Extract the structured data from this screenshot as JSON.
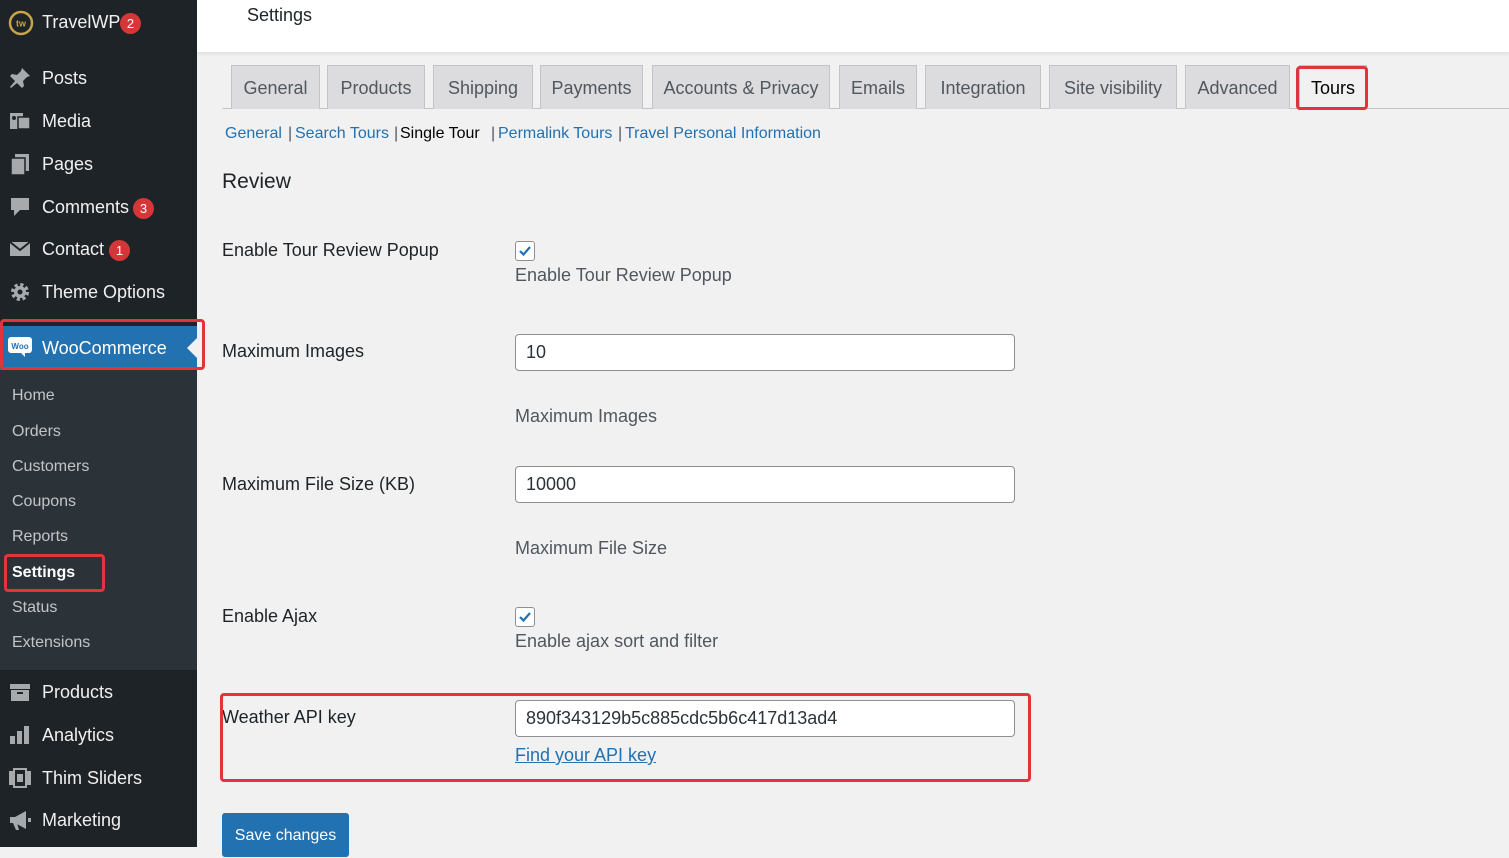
{
  "sidebar": {
    "site": {
      "label": "TravelWP",
      "badge": "2",
      "logo_text": "tw"
    },
    "items": [
      {
        "label": "Posts",
        "icon": "pushpin-icon"
      },
      {
        "label": "Media",
        "icon": "media-icon"
      },
      {
        "label": "Pages",
        "icon": "pages-icon"
      },
      {
        "label": "Comments",
        "icon": "comment-icon",
        "badge": "3"
      },
      {
        "label": "Contact",
        "icon": "envelope-icon",
        "badge": "1"
      },
      {
        "label": "Theme Options",
        "icon": "gear-icon"
      }
    ],
    "woocommerce": {
      "label": "WooCommerce",
      "icon": "woo-icon",
      "icon_text": "Woo"
    },
    "submenu": [
      "Home",
      "Orders",
      "Customers",
      "Coupons",
      "Reports",
      "Settings",
      "Status",
      "Extensions"
    ],
    "bottom_items": [
      {
        "label": "Products",
        "icon": "archive-icon"
      },
      {
        "label": "Analytics",
        "icon": "bar-chart-icon"
      },
      {
        "label": "Thim Sliders",
        "icon": "slides-icon"
      },
      {
        "label": "Marketing",
        "icon": "megaphone-icon"
      }
    ]
  },
  "header": {
    "title": "Settings"
  },
  "tabs": [
    "General",
    "Products",
    "Shipping",
    "Payments",
    "Accounts & Privacy",
    "Emails",
    "Integration",
    "Site visibility",
    "Advanced",
    "Tours"
  ],
  "active_tab": "Tours",
  "subnav": {
    "items": [
      "General",
      "Search Tours",
      "Single Tour",
      "Permalink Tours",
      "Travel Personal Information"
    ],
    "separator": "|",
    "current": "Single Tour"
  },
  "section": {
    "heading": "Review"
  },
  "fields": {
    "review_popup": {
      "label": "Enable Tour Review Popup",
      "checked": true,
      "description": "Enable Tour Review Popup"
    },
    "max_images": {
      "label": "Maximum Images",
      "value": "10",
      "description": "Maximum Images"
    },
    "max_file_size": {
      "label": "Maximum File Size (KB)",
      "value": "10000",
      "description": "Maximum File Size"
    },
    "ajax": {
      "label": "Enable Ajax",
      "checked": true,
      "description": "Enable ajax sort and filter"
    },
    "weather_api": {
      "label": "Weather API key",
      "value": "890f343129b5c885cdc5b6c417d13ad4",
      "link_text": "Find your API key"
    }
  },
  "save_button": "Save changes",
  "colors": {
    "sidebar_bg": "#1d2327",
    "submenu_bg": "#2c3338",
    "accent": "#2271b1",
    "badge": "#d63638",
    "highlight": "#e0353d"
  }
}
